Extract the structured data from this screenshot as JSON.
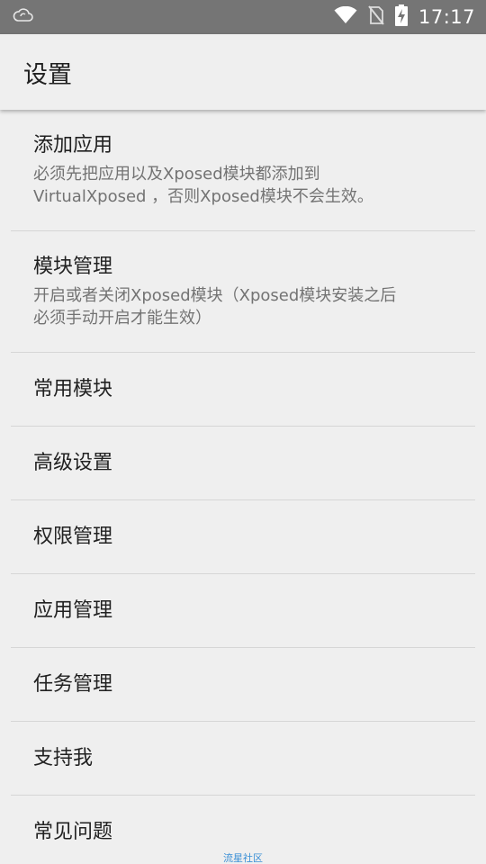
{
  "status_bar": {
    "time": "17:17",
    "icons": {
      "left": "cloud-notification-icon",
      "wifi": "wifi-icon",
      "sim": "no-sim-icon",
      "battery": "battery-charging-icon"
    }
  },
  "app_bar": {
    "title": "设置"
  },
  "settings": {
    "items": [
      {
        "title": "添加应用",
        "desc_line1": "必须先把应用以及Xposed模块都添加到",
        "desc_line2": "VirtualXposed ，否则Xposed模块不会生效。"
      },
      {
        "title": "模块管理",
        "desc_line1": "开启或者关闭Xposed模块（Xposed模块安装之后",
        "desc_line2": "必须手动开启才能生效）"
      },
      {
        "title": "常用模块"
      },
      {
        "title": "高级设置"
      },
      {
        "title": "权限管理"
      },
      {
        "title": "应用管理"
      },
      {
        "title": "任务管理"
      },
      {
        "title": "支持我"
      },
      {
        "title": "常见问题"
      }
    ]
  },
  "watermark": "流星社区",
  "colors": {
    "status_bar": "#757575",
    "background": "#efefef",
    "divider": "#d6d6d6",
    "title_text": "#212121",
    "desc_text": "#737373",
    "watermark": "#3a8fd6"
  }
}
